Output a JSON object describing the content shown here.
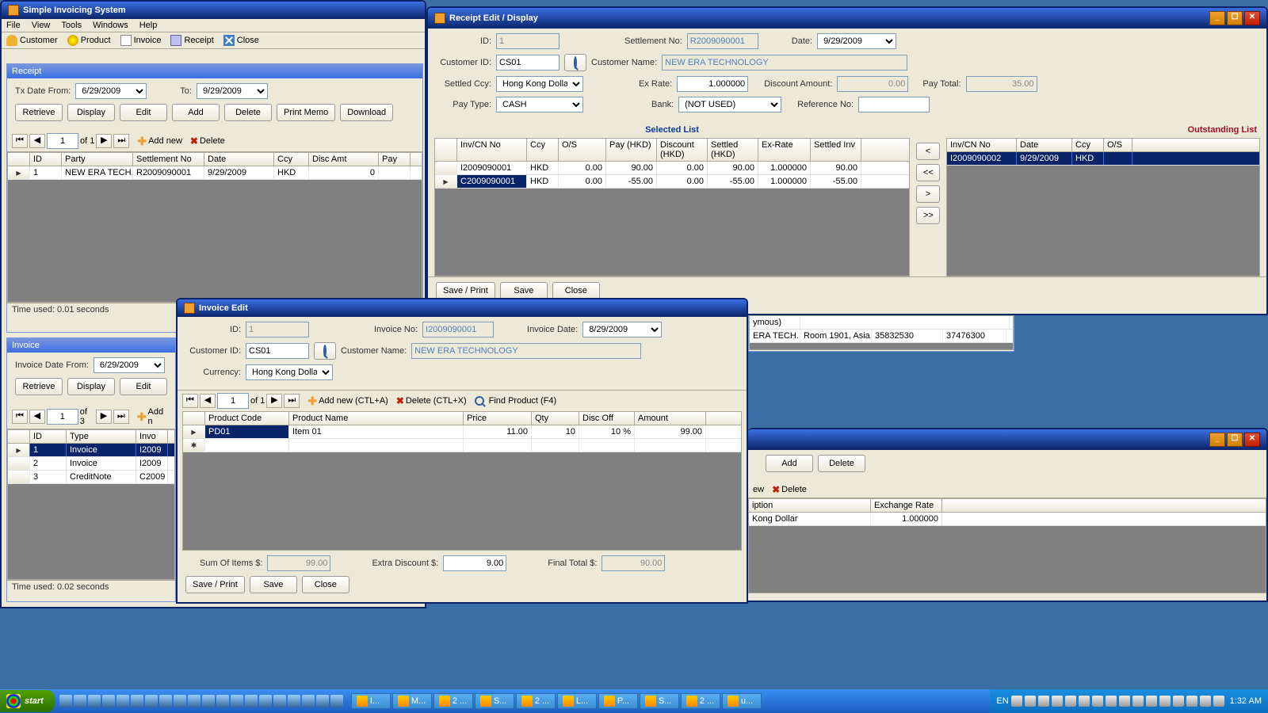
{
  "main": {
    "title": "Simple Invoicing System",
    "menu": [
      "File",
      "View",
      "Tools",
      "Windows",
      "Help"
    ],
    "toolbar": [
      "Customer",
      "Product",
      "Invoice",
      "Receipt",
      "Close"
    ]
  },
  "receiptList": {
    "title": "Receipt",
    "fromLabel": "Tx Date From:",
    "fromDate": "6/29/2009",
    "toLabel": "To:",
    "toDate": "9/29/2009",
    "buttons": [
      "Retrieve",
      "Display",
      "Edit",
      "Add",
      "Delete",
      "Print Memo",
      "Download"
    ],
    "nav": {
      "pos": "1",
      "of": "of 1",
      "addnew": "Add new",
      "delete": "Delete"
    },
    "cols": [
      "ID",
      "Party",
      "Settlement No",
      "Date",
      "Ccy",
      "Disc Amt",
      "Pay"
    ],
    "rows": [
      {
        "id": "1",
        "party": "NEW ERA TECH...",
        "settle": "R2009090001",
        "date": "9/29/2009",
        "ccy": "HKD",
        "disc": "0",
        "pay": ""
      }
    ],
    "status": "Time used: 0.01 seconds"
  },
  "invoiceList": {
    "title": "Invoice",
    "fromLabel": "Invoice Date From:",
    "fromDate": "6/29/2009",
    "buttons": [
      "Retrieve",
      "Display",
      "Edit"
    ],
    "nav": {
      "pos": "1",
      "of": "of 3",
      "addnew": "Add n"
    },
    "cols": [
      "ID",
      "Type",
      "Invo"
    ],
    "rows": [
      {
        "id": "1",
        "type": "Invoice",
        "inv": "I2009"
      },
      {
        "id": "2",
        "type": "Invoice",
        "inv": "I2009"
      },
      {
        "id": "3",
        "type": "CreditNote",
        "inv": "C2009"
      }
    ],
    "status": "Time used: 0.02 seconds"
  },
  "receiptEdit": {
    "title": "Receipt Edit / Display",
    "labels": {
      "id": "ID:",
      "settleNo": "Settlement No:",
      "date": "Date:",
      "custId": "Customer ID:",
      "custName": "Customer Name:",
      "settledCcy": "Settled Ccy:",
      "exRate": "Ex Rate:",
      "discAmt": "Discount Amount:",
      "payTotal": "Pay Total:",
      "payType": "Pay Type:",
      "bank": "Bank:",
      "refNo": "Reference No:"
    },
    "values": {
      "id": "1",
      "settleNo": "R2009090001",
      "date": "9/29/2009",
      "custId": "CS01",
      "custName": "NEW ERA TECHNOLOGY",
      "settledCcy": "Hong Kong Dollar",
      "exRate": "1.000000",
      "discAmt": "0.00",
      "payTotal": "35.00",
      "payType": "CASH",
      "bank": "(NOT USED)",
      "refNo": ""
    },
    "selectedLabel": "Selected List",
    "outstandingLabel": "Outstanding List",
    "selCols": [
      "Inv/CN No",
      "Ccy",
      "O/S",
      "Pay (HKD)",
      "Discount (HKD)",
      "Settled (HKD)",
      "Ex-Rate",
      "Settled Inv"
    ],
    "selRows": [
      {
        "inv": "I2009090001",
        "ccy": "HKD",
        "os": "0.00",
        "pay": "90.00",
        "disc": "0.00",
        "settled": "90.00",
        "rate": "1.000000",
        "settledInv": "90.00"
      },
      {
        "inv": "C2009090001",
        "ccy": "HKD",
        "os": "0.00",
        "pay": "-55.00",
        "disc": "0.00",
        "settled": "-55.00",
        "rate": "1.000000",
        "settledInv": "-55.00"
      }
    ],
    "outCols": [
      "Inv/CN No",
      "Date",
      "Ccy",
      "O/S"
    ],
    "outRows": [
      {
        "inv": "I2009090002",
        "date": "9/29/2009",
        "ccy": "HKD",
        "os": ""
      }
    ],
    "moveBtns": [
      "<",
      "<<",
      ">",
      ">>"
    ],
    "footerBtns": [
      "Save / Print",
      "Save",
      "Close"
    ]
  },
  "invoiceEdit": {
    "title": "Invoice Edit",
    "labels": {
      "id": "ID:",
      "invNo": "Invoice No:",
      "invDate": "Invoice Date:",
      "custId": "Customer ID:",
      "custName": "Customer Name:",
      "currency": "Currency:"
    },
    "values": {
      "id": "1",
      "invNo": "I2009090001",
      "invDate": "8/29/2009",
      "custId": "CS01",
      "custName": "NEW ERA TECHNOLOGY",
      "currency": "Hong Kong Dollar"
    },
    "nav": {
      "pos": "1",
      "of": "of 1",
      "addnew": "Add new (CTL+A)",
      "delete": "Delete (CTL+X)",
      "find": "Find Product (F4)"
    },
    "cols": [
      "Product Code",
      "Product Name",
      "Price",
      "Qty",
      "Disc Off",
      "Amount"
    ],
    "rows": [
      {
        "code": "PD01",
        "name": "Item 01",
        "price": "11.00",
        "qty": "10",
        "disc": "10 %",
        "amt": "99.00"
      }
    ],
    "totals": {
      "sumLabel": "Sum Of Items $:",
      "sum": "99.00",
      "extraLabel": "Extra Discount $:",
      "extra": "9.00",
      "finalLabel": "Final Total $:",
      "final": "90.00"
    },
    "footerBtns": [
      "Save / Print",
      "Save",
      "Close"
    ]
  },
  "customerPartial": {
    "row": {
      "n1": "ymous)",
      "n2": "ERA TECH...",
      "addr": "Room 1901, Asia...",
      "tel": "35832530",
      "fax": "37476300"
    },
    "buttons": [
      "Add",
      "Delete"
    ],
    "nav": {
      "addnew": "ew",
      "delete": "Delete"
    },
    "cols": [
      "iption",
      "Exchange Rate"
    ],
    "cell1": "Kong Dollar",
    "cellRate": "1.000000"
  },
  "taskbar": {
    "start": "start",
    "tasks": [
      "I...",
      "M...",
      "2 ...",
      "S...",
      "2 ...",
      "L...",
      "P...",
      "S...",
      "2 ...",
      "u..."
    ],
    "lang": "EN",
    "clock": "1:32 AM"
  }
}
